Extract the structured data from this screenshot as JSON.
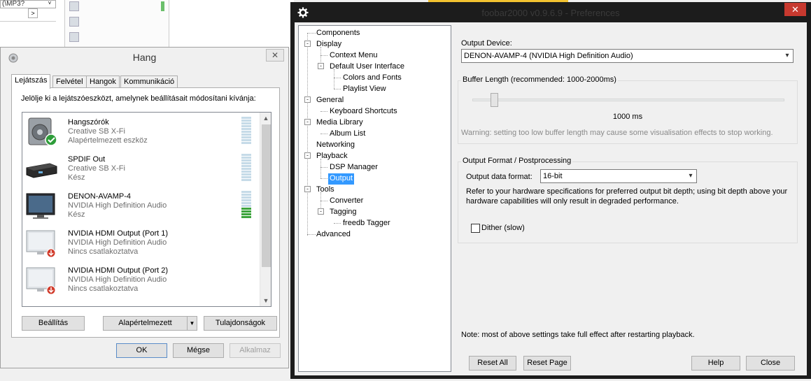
{
  "background": {
    "combo_text": "(\\MP3?",
    "combo_arrow": "˅",
    "nav_arrow": ">"
  },
  "hang": {
    "title": "Hang",
    "close": "✕",
    "tabs": [
      "Lejátszás",
      "Felvétel",
      "Hangok",
      "Kommunikáció"
    ],
    "instruction": "Jelölje ki a lejátszóeszközt, amelynek beállításait módosítani kívánja:",
    "devices": [
      {
        "name": "Hangszórók",
        "sub1": "Creative SB X-Fi",
        "sub2": "Alapértelmezett eszköz",
        "icon": "speaker-default-icon",
        "meter_level": 0.0
      },
      {
        "name": "SPDIF Out",
        "sub1": "Creative SB X-Fi",
        "sub2": "Kész",
        "icon": "spdif-device-icon",
        "meter_level": 0.0
      },
      {
        "name": "DENON-AVAMP-4",
        "sub1": "NVIDIA High Definition Audio",
        "sub2": "Kész",
        "icon": "monitor-icon",
        "meter_level": 0.4
      },
      {
        "name": "NVIDIA HDMI Output (Port 1)",
        "sub1": "NVIDIA High Definition Audio",
        "sub2": "Nincs csatlakoztatva",
        "icon": "monitor-disconnected-icon",
        "meter_level": 0
      },
      {
        "name": "NVIDIA HDMI Output (Port 2)",
        "sub1": "NVIDIA High Definition Audio",
        "sub2": "Nincs csatlakoztatva",
        "icon": "monitor-disconnected-icon",
        "meter_level": 0
      }
    ],
    "buttons": {
      "configure": "Beállítás",
      "set_default": "Alapértelmezett",
      "properties": "Tulajdonságok",
      "ok": "OK",
      "cancel": "Mégse",
      "apply": "Alkalmaz"
    }
  },
  "foobar": {
    "title": "foobar2000 v0.9.6.9 - Preferences",
    "close": "✕",
    "tree": {
      "components": "Components",
      "display": "Display",
      "context_menu": "Context Menu",
      "default_ui": "Default User Interface",
      "colors_fonts": "Colors and Fonts",
      "playlist_view": "Playlist View",
      "general": "General",
      "keyboard_shortcuts": "Keyboard Shortcuts",
      "media_library": "Media Library",
      "album_list": "Album List",
      "networking": "Networking",
      "playback": "Playback",
      "dsp_manager": "DSP Manager",
      "output": "Output",
      "tools": "Tools",
      "converter": "Converter",
      "tagging": "Tagging",
      "freedb_tagger": "freedb Tagger",
      "advanced": "Advanced",
      "minus": "-"
    },
    "output_device_label": "Output Device:",
    "output_device_value": "DENON-AVAMP-4 (NVIDIA High Definition Audio)",
    "buffer_group_title": "Buffer Length (recommended: 1000-2000ms)",
    "buffer_value": "1000 ms",
    "buffer_slider_fraction": 0.07,
    "buffer_warning": "Warning: setting too low buffer length may cause some visualisation effects to stop working.",
    "format_group_title": "Output Format / Postprocessing",
    "format_label": "Output data format:",
    "format_value": "16-bit",
    "format_help_line1": "Refer to your hardware specifications for preferred output bit depth; using bit depth above your",
    "format_help_line2": "hardware capabilities will only result in degraded performance.",
    "dither_label": "Dither (slow)",
    "dither_checked": false,
    "note": "Note: most of above settings take full effect after restarting playback.",
    "buttons": {
      "reset_all": "Reset All",
      "reset_page": "Reset Page",
      "help": "Help",
      "close": "Close"
    },
    "dropdown_arrow": "▾"
  },
  "colors": {
    "selection": "#3399ff",
    "close_red": "#c7392f",
    "meter_on": "#3ca43c",
    "meter_off": "#c6dbe8"
  }
}
